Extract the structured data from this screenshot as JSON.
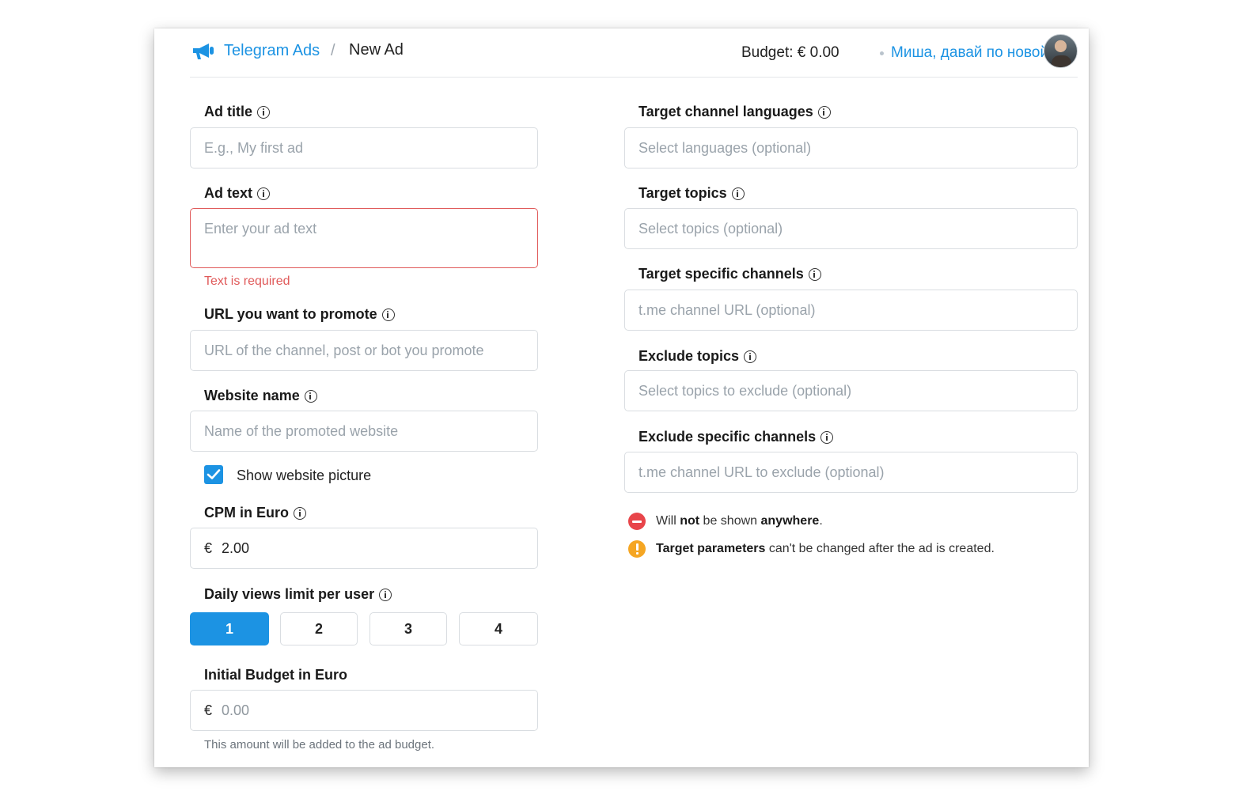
{
  "header": {
    "brand": "Telegram Ads",
    "separator": "/",
    "current_page": "New Ad",
    "budget": "Budget: € 0.00",
    "account_name": "Миша, давай по новой"
  },
  "left": {
    "ad_title": {
      "label": "Ad title",
      "placeholder": "E.g., My first ad"
    },
    "ad_text": {
      "label": "Ad text",
      "placeholder": "Enter your ad text",
      "error": "Text is required"
    },
    "url": {
      "label": "URL you want to promote",
      "placeholder": "URL of the channel, post or bot you promote"
    },
    "website_name": {
      "label": "Website name",
      "placeholder": "Name of the promoted website"
    },
    "show_picture": {
      "label": "Show website picture",
      "checked": true
    },
    "cpm": {
      "label": "CPM in Euro",
      "currency": "€",
      "value": "2.00"
    },
    "daily_views": {
      "label": "Daily views limit per user",
      "options": [
        "1",
        "2",
        "3",
        "4"
      ],
      "selected": "1"
    },
    "initial_budget": {
      "label": "Initial Budget in Euro",
      "currency": "€",
      "value": "0.00",
      "hint": "This amount will be added to the ad budget."
    }
  },
  "right": {
    "languages": {
      "label": "Target channel languages",
      "placeholder": "Select languages (optional)"
    },
    "topics": {
      "label": "Target topics",
      "placeholder": "Select topics (optional)"
    },
    "channels": {
      "label": "Target specific channels",
      "placeholder": "t.me channel URL (optional)"
    },
    "exclude_topics": {
      "label": "Exclude topics",
      "placeholder": "Select topics to exclude (optional)"
    },
    "exclude_channels": {
      "label": "Exclude specific channels",
      "placeholder": "t.me channel URL to exclude (optional)"
    },
    "notice_1": {
      "pre": "Will",
      "bold1": "not",
      "mid": "be shown",
      "bold2": "anywhere",
      "post": "."
    },
    "notice_2": {
      "bold": "Target parameters",
      "rest": "can't be changed after the ad is created."
    }
  },
  "colors": {
    "accent": "#1c93e3",
    "error": "#e05a5a",
    "warning": "#f5a623"
  }
}
